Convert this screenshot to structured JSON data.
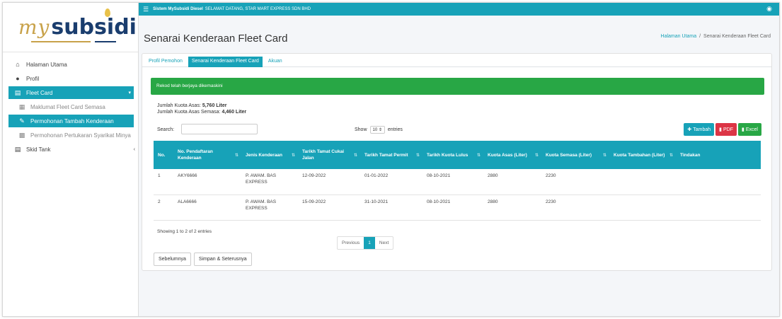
{
  "logo": {
    "my": "my",
    "subsidi": "subsidi"
  },
  "sidebar": {
    "items": [
      {
        "label": "Halaman Utama",
        "icon": "home-icon"
      },
      {
        "label": "Profil",
        "icon": "user-icon"
      },
      {
        "label": "Fleet Card",
        "icon": "id-card-icon"
      },
      {
        "label": "Maklumat Fleet Card Semasa",
        "icon": "building-icon"
      },
      {
        "label": "Permohonan Tambah Kenderaan",
        "icon": "edit-icon"
      },
      {
        "label": "Permohonan Pertukaran Syarikat Minya",
        "icon": "truck-icon"
      },
      {
        "label": "Skid Tank",
        "icon": "id-card-icon"
      }
    ]
  },
  "topbar": {
    "system": "Sistem MySubsidi Diesel",
    "welcome": "SELAMAT DATANG, STAR MART EXPRESS SDN BHD"
  },
  "page": {
    "title": "Senarai Kenderaan Fleet Card",
    "breadcrumb": {
      "home": "Halaman Utama",
      "sep": "/",
      "current": "Senarai Kenderaan Fleet Card"
    }
  },
  "tabs": [
    {
      "label": "Profil Pemohon"
    },
    {
      "label": "Senarai Kenderaan Fleet Card"
    },
    {
      "label": "Akuan"
    }
  ],
  "alert": "Rekod telah berjaya dikemaskini",
  "quota": {
    "asas_label": "Jumlah Kuota Asas:",
    "asas_value": "5,760 Liter",
    "semasa_label": "Jumlah Kuota Asas Semasa:",
    "semasa_value": "4,460 Liter"
  },
  "controls": {
    "search_label": "Search:",
    "show_label": "Show",
    "show_value": "10",
    "entries_label": "entries",
    "tambah": "Tambah",
    "pdf": "PDF",
    "excel": "Excel"
  },
  "table": {
    "headers": [
      "No.",
      "No. Pendaftaran Kenderaan",
      "Jenis Kenderaan",
      "Tarikh Tamat Cukai Jalan",
      "Tarikh Tamat Permit",
      "Tarikh Kuota Lulus",
      "Kuota Asas (Liter)",
      "Kuota Semasa (Liter)",
      "Kuota Tambahan (Liter)",
      "Tindakan"
    ],
    "rows": [
      [
        "1",
        "AKY6666",
        "P. AWAM. BAS EXPRESS",
        "12-09-2022",
        "01-01-2022",
        "08-10-2021",
        "2880",
        "2230",
        "",
        ""
      ],
      [
        "2",
        "ALA6666",
        "P. AWAM. BAS EXPRESS",
        "15-09-2022",
        "31-10-2021",
        "08-10-2021",
        "2880",
        "2230",
        "",
        ""
      ]
    ]
  },
  "footer": {
    "showing": "Showing 1 to 2 of 2 entries",
    "previous": "Previous",
    "page": "1",
    "next": "Next",
    "sebelumnya": "Sebelumnya",
    "simpan": "Simpan & Seterusnya"
  },
  "colors": {
    "accent": "#17a2b8",
    "success": "#28a745",
    "danger": "#dc3545"
  }
}
